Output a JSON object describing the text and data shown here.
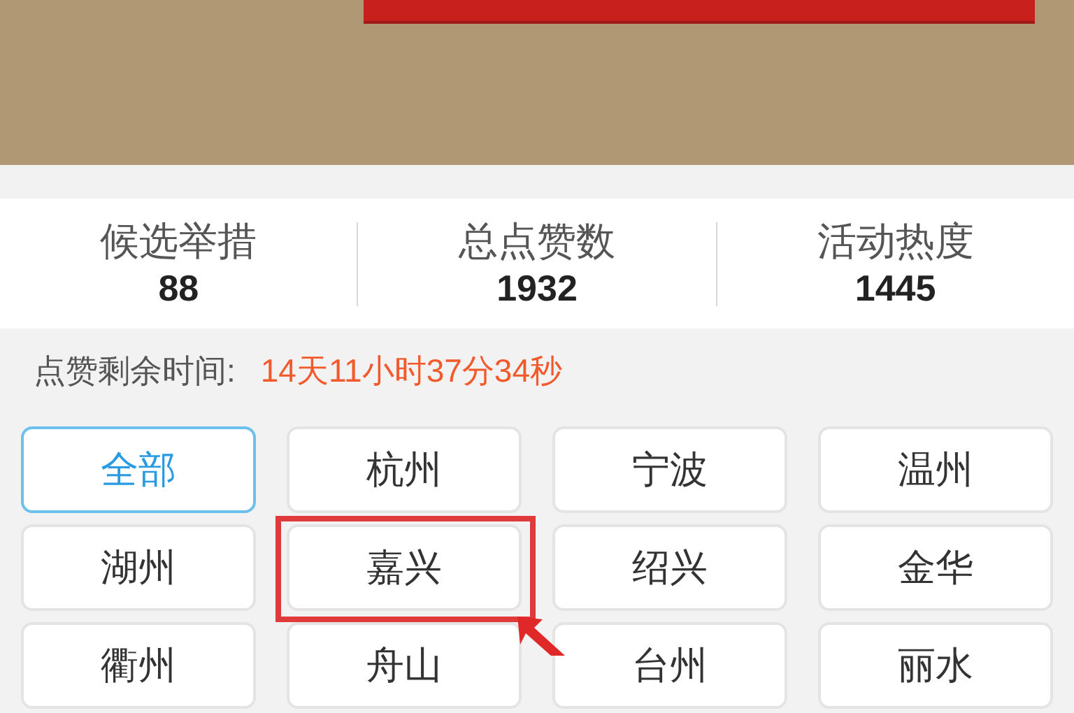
{
  "stats": [
    {
      "label": "候选举措",
      "value": "88"
    },
    {
      "label": "总点赞数",
      "value": "1932"
    },
    {
      "label": "活动热度",
      "value": "1445"
    }
  ],
  "countdown": {
    "label": "点赞剩余时间:",
    "value": "14天11小时37分34秒"
  },
  "regions": [
    {
      "label": "全部",
      "selected": true,
      "annotated": false
    },
    {
      "label": "杭州",
      "selected": false,
      "annotated": false
    },
    {
      "label": "宁波",
      "selected": false,
      "annotated": false
    },
    {
      "label": "温州",
      "selected": false,
      "annotated": false
    },
    {
      "label": "湖州",
      "selected": false,
      "annotated": false
    },
    {
      "label": "嘉兴",
      "selected": false,
      "annotated": true
    },
    {
      "label": "绍兴",
      "selected": false,
      "annotated": false
    },
    {
      "label": "金华",
      "selected": false,
      "annotated": false
    },
    {
      "label": "衢州",
      "selected": false,
      "annotated": false
    },
    {
      "label": "舟山",
      "selected": false,
      "annotated": false
    },
    {
      "label": "台州",
      "selected": false,
      "annotated": false
    },
    {
      "label": "丽水",
      "selected": false,
      "annotated": false
    }
  ]
}
